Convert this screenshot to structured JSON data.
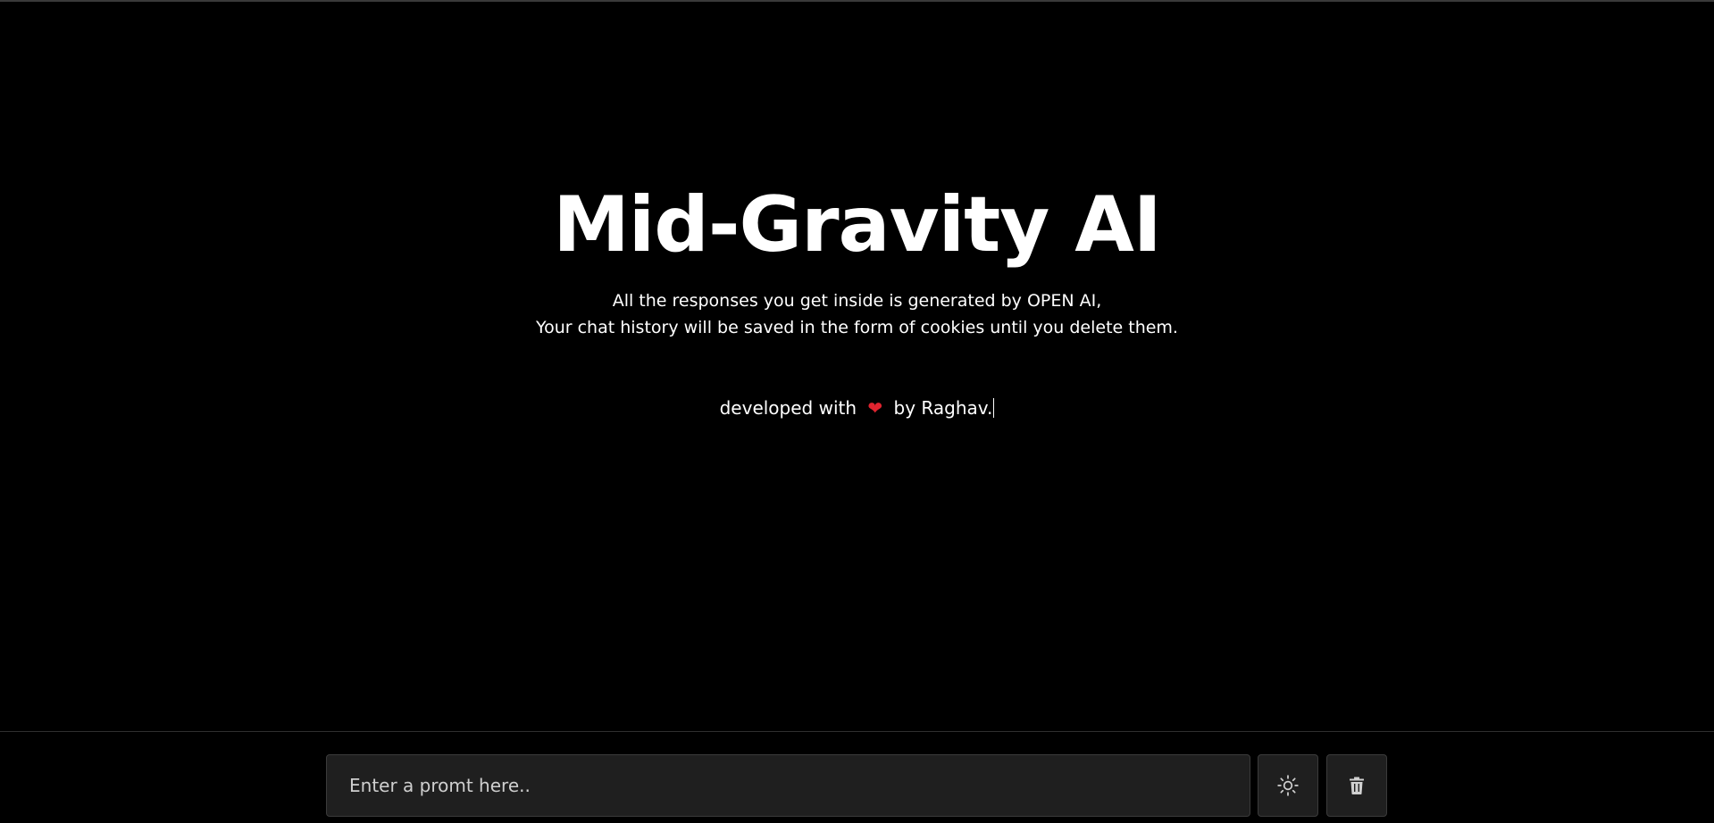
{
  "hero": {
    "title": "Mid-Gravity AI",
    "subtitle_line1": "All the responses you get inside is generated by OPEN AI,",
    "subtitle_line2": "Your chat history will be saved in the form of cookies until you delete them.",
    "credit_prefix": "developed with",
    "credit_heart": "❤",
    "credit_suffix": "by Raghav."
  },
  "composer": {
    "placeholder": "Enter a promt here..",
    "value": "",
    "theme_icon": "sun-icon",
    "delete_icon": "trash-icon"
  },
  "colors": {
    "background": "#000000",
    "text": "#ffffff",
    "input_bg": "#1f1f1f",
    "border": "#3b3b3b",
    "heart": "#e0242f"
  }
}
